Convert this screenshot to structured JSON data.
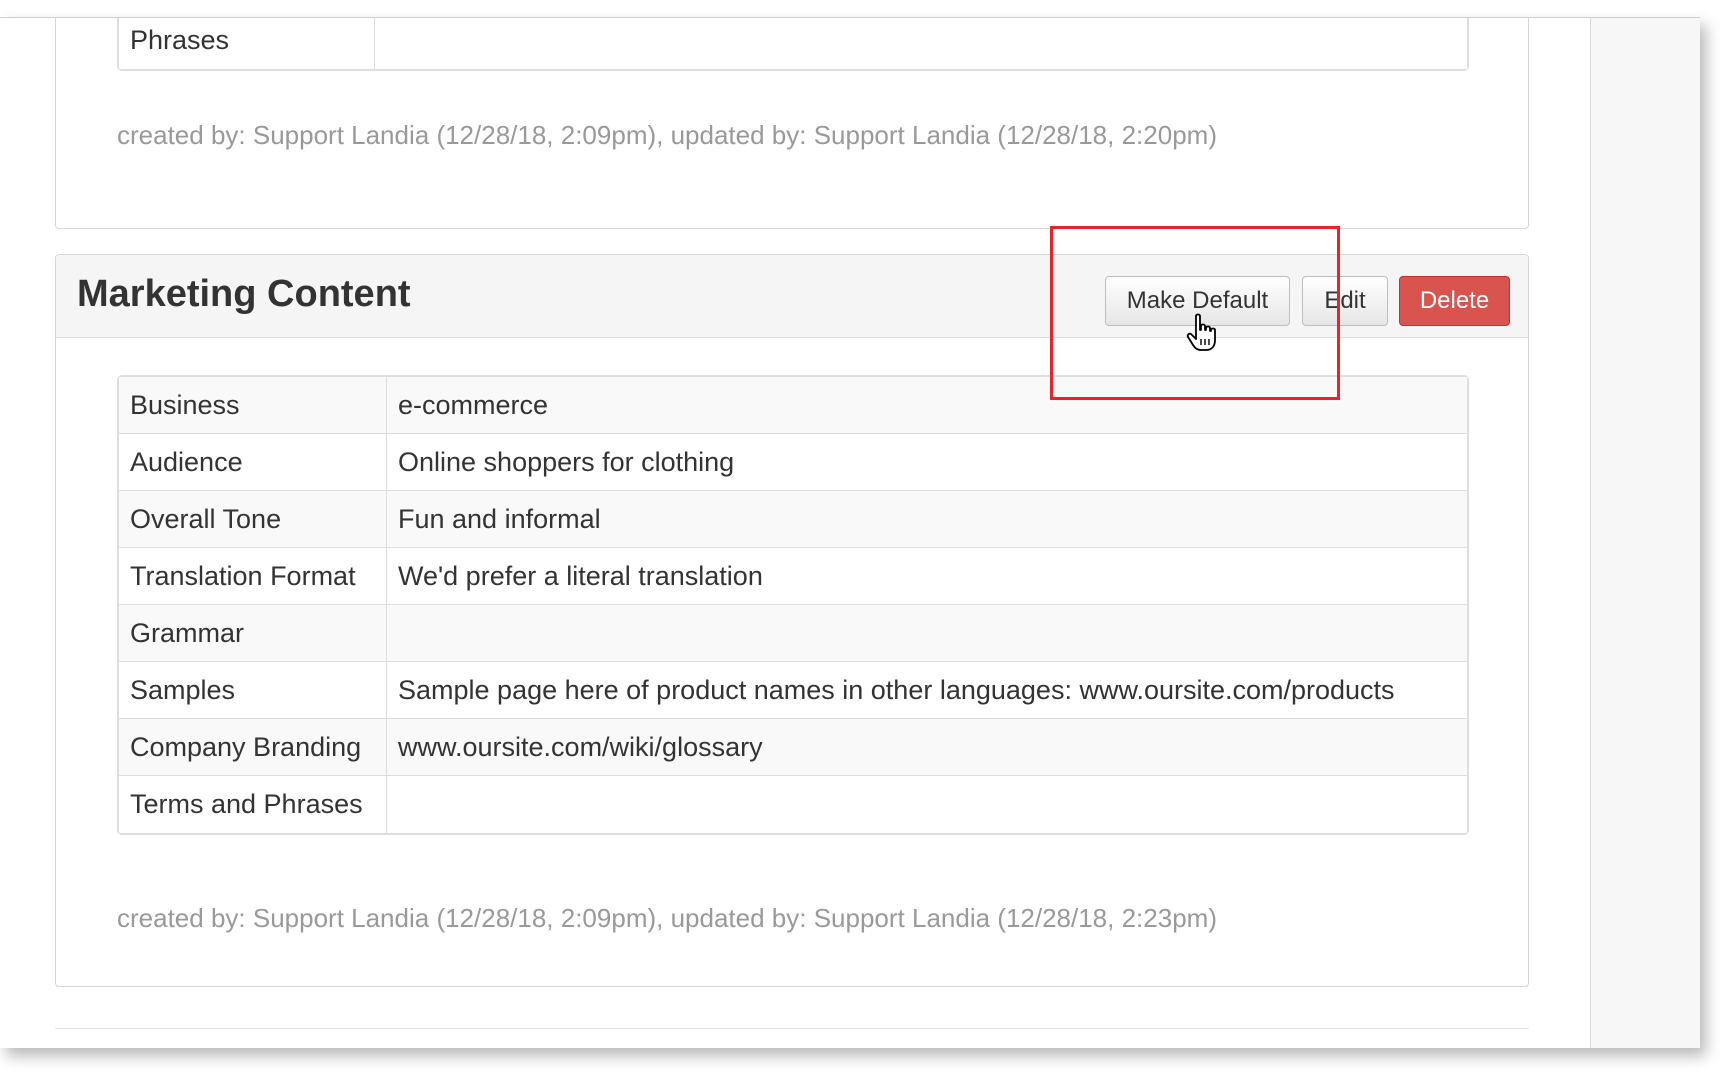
{
  "top_section": {
    "rows": [
      {
        "label": "Phrases",
        "value": ""
      }
    ],
    "meta": "created by: Support Landia (12/28/18, 2:09pm), updated by: Support Landia (12/28/18, 2:20pm)"
  },
  "marketing_section": {
    "title": "Marketing Content",
    "buttons": {
      "make_default": "Make Default",
      "edit": "Edit",
      "delete": "Delete"
    },
    "rows": [
      {
        "label": "Business",
        "value": "e-commerce"
      },
      {
        "label": "Audience",
        "value": "Online shoppers for clothing"
      },
      {
        "label": "Overall Tone",
        "value": "Fun and informal"
      },
      {
        "label": "Translation Format",
        "value": "We'd prefer a literal translation"
      },
      {
        "label": "Grammar",
        "value": ""
      },
      {
        "label": "Samples",
        "value": "Sample page here of product names in other languages: www.oursite.com/products"
      },
      {
        "label": "Company Branding",
        "value": "www.oursite.com/wiki/glossary"
      },
      {
        "label": "Terms and Phrases",
        "value": ""
      }
    ],
    "meta": "created by: Support Landia (12/28/18, 2:09pm), updated by: Support Landia (12/28/18, 2:23pm)"
  },
  "colors": {
    "danger": "#d9534f",
    "highlight": "#e8232a",
    "muted_text": "#999999"
  },
  "icons": {
    "cursor": "hand-pointer-icon"
  }
}
